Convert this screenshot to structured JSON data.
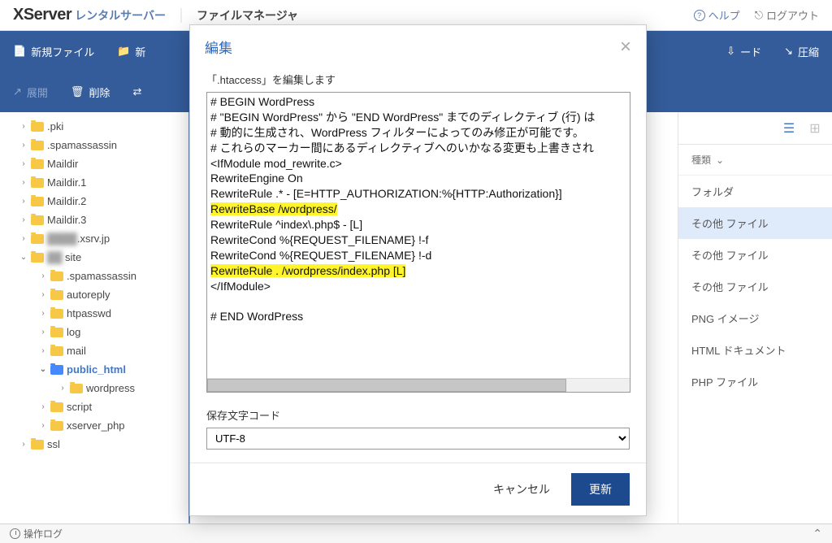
{
  "header": {
    "logo_main": "XServer",
    "logo_sub": "レンタルサーバー",
    "page_title": "ファイルマネージャ",
    "help": "ヘルプ",
    "logout": "ログアウト"
  },
  "toolbar": {
    "row1": [
      {
        "icon": "file-plus-icon",
        "label": "新規ファイル"
      },
      {
        "icon": "folder-plus-icon",
        "label": "新",
        "dim": false
      },
      {
        "icon": "download-icon",
        "label": "ード"
      },
      {
        "icon": "compress-icon",
        "label": "圧縮"
      }
    ],
    "row2": [
      {
        "icon": "expand-icon",
        "label": "展開",
        "dim": true
      },
      {
        "icon": "trash-icon",
        "label": "削除"
      },
      {
        "icon": "move-icon",
        "label": ""
      }
    ]
  },
  "sidebar": {
    "items": [
      {
        "level": 1,
        "caret": "›",
        "label": ".pki"
      },
      {
        "level": 1,
        "caret": "›",
        "label": ".spamassassin"
      },
      {
        "level": 1,
        "caret": "›",
        "label": "Maildir"
      },
      {
        "level": 1,
        "caret": "›",
        "label": "Maildir.1"
      },
      {
        "level": 1,
        "caret": "›",
        "label": "Maildir.2"
      },
      {
        "level": 1,
        "caret": "›",
        "label": "Maildir.3"
      },
      {
        "level": 1,
        "caret": "›",
        "label": ".xsrv.jp",
        "blur": true
      },
      {
        "level": 1,
        "caret": "⌄",
        "label": " site",
        "blur_prefix": true
      },
      {
        "level": 2,
        "caret": "›",
        "label": ".spamassassin"
      },
      {
        "level": 2,
        "caret": "›",
        "label": "autoreply"
      },
      {
        "level": 2,
        "caret": "›",
        "label": "htpasswd"
      },
      {
        "level": 2,
        "caret": "›",
        "label": "log"
      },
      {
        "level": 2,
        "caret": "›",
        "label": "mail"
      },
      {
        "level": 2,
        "caret": "⌄",
        "label": "public_html",
        "selected": true
      },
      {
        "level": 3,
        "caret": "›",
        "label": "wordpress"
      },
      {
        "level": 2,
        "caret": "›",
        "label": "script"
      },
      {
        "level": 2,
        "caret": "›",
        "label": "xserver_php"
      },
      {
        "level": 1,
        "caret": "›",
        "label": "ssl"
      }
    ]
  },
  "file_side": {
    "col_header": "種類",
    "rows": [
      {
        "label": "フォルダ"
      },
      {
        "label": "その他 ファイル",
        "hl": true
      },
      {
        "label": "その他 ファイル"
      },
      {
        "label": "その他 ファイル"
      },
      {
        "label": "PNG イメージ"
      },
      {
        "label": "HTML ドキュメント"
      },
      {
        "label": "PHP ファイル"
      }
    ]
  },
  "footer": {
    "log": "操作ログ"
  },
  "modal": {
    "title": "編集",
    "label": "「.htaccess」を編集します",
    "content_lines": [
      {
        "t": "# BEGIN WordPress"
      },
      {
        "t": "# \"BEGIN WordPress\" から \"END WordPress\" までのディレクティブ (行) は"
      },
      {
        "t": "# 動的に生成され、WordPress フィルターによってのみ修正が可能です。"
      },
      {
        "t": "# これらのマーカー間にあるディレクティブへのいかなる変更も上書きされ"
      },
      {
        "t": "<IfModule mod_rewrite.c>"
      },
      {
        "t": "RewriteEngine On"
      },
      {
        "t": "RewriteRule .* - [E=HTTP_AUTHORIZATION:%{HTTP:Authorization}]"
      },
      {
        "t": "RewriteBase /wordpress/",
        "hl": true
      },
      {
        "t": "RewriteRule ^index\\.php$ - [L]"
      },
      {
        "t": "RewriteCond %{REQUEST_FILENAME} !-f"
      },
      {
        "t": "RewriteCond %{REQUEST_FILENAME} !-d"
      },
      {
        "t": "RewriteRule . /wordpress/index.php [L]",
        "hl": true
      },
      {
        "t": "</IfModule>"
      },
      {
        "t": ""
      },
      {
        "t": "# END WordPress"
      }
    ],
    "enc_label": "保存文字コード",
    "enc_value": "UTF-8",
    "cancel": "キャンセル",
    "update": "更新"
  }
}
